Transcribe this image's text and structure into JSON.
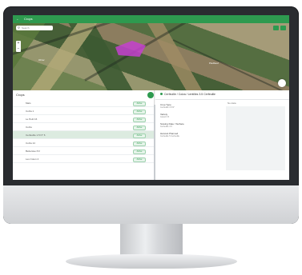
{
  "header": {
    "back_icon": "arrow-left-icon",
    "title": "Crops"
  },
  "map": {
    "search_placeholder": "Search",
    "zoom_in": "+",
    "zoom_out": "−",
    "places": [
      "Ohrer",
      "Piedbeuf"
    ]
  },
  "list": {
    "title": "Crops",
    "items": [
      {
        "label": "Maïs",
        "badge": "Active",
        "selected": false
      },
      {
        "label": "Colza 1",
        "badge": "Active",
        "selected": false
      },
      {
        "label": "Le Petit 16",
        "badge": "Active",
        "selected": false
      },
      {
        "label": "Colza",
        "badge": "Active",
        "selected": false
      },
      {
        "label": "Cerfeuille 1.5 N° 6",
        "badge": "Active",
        "selected": true
      },
      {
        "label": "Colza 14",
        "badge": "Active",
        "selected": false
      },
      {
        "label": "Betterave P.2",
        "badge": "Active",
        "selected": false
      },
      {
        "label": "Les Coton 4",
        "badge": "Active",
        "selected": false
      }
    ]
  },
  "detail": {
    "title": "Cerfeuille / Colza / Lentilles 3.5 Cerfeuille",
    "fields": [
      {
        "label": "Crop Type",
        "value": "Cerfeuille 3.5 N°"
      },
      {
        "label": "Variety",
        "value": "Grand 3.5"
      },
      {
        "label": "Sowing Date / Surface",
        "value": "Cerfeuille 3.5"
      },
      {
        "label": "Harvest Planned",
        "value": "Cerfeuille 5 Cerfeuille"
      }
    ],
    "side_note": "No data"
  }
}
